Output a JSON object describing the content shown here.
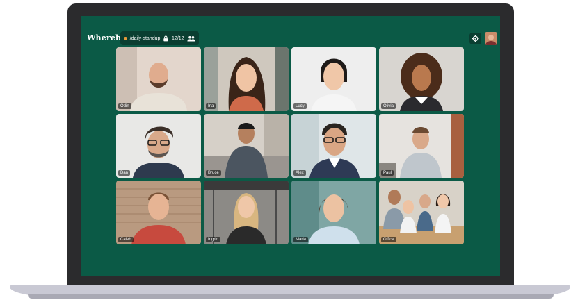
{
  "app": {
    "logo": "Whereby",
    "room_name": "/daily-standup",
    "participant_count": "12/12",
    "colors": {
      "screen_bg": "#0b5a46",
      "pill_bg": "#0a3e31",
      "status_dot": "#e59a3a"
    },
    "icons": {
      "lock": "lock-icon",
      "people": "people-icon",
      "settings": "gear-icon"
    }
  },
  "participants": [
    {
      "name": "Odin"
    },
    {
      "name": "Ina"
    },
    {
      "name": "Lucy"
    },
    {
      "name": "Olivia"
    },
    {
      "name": "Dan"
    },
    {
      "name": "Bruce"
    },
    {
      "name": "Alex"
    },
    {
      "name": "Paul"
    },
    {
      "name": "Caleb"
    },
    {
      "name": "Ingrid"
    },
    {
      "name": "Maria"
    },
    {
      "name": "Office"
    }
  ]
}
